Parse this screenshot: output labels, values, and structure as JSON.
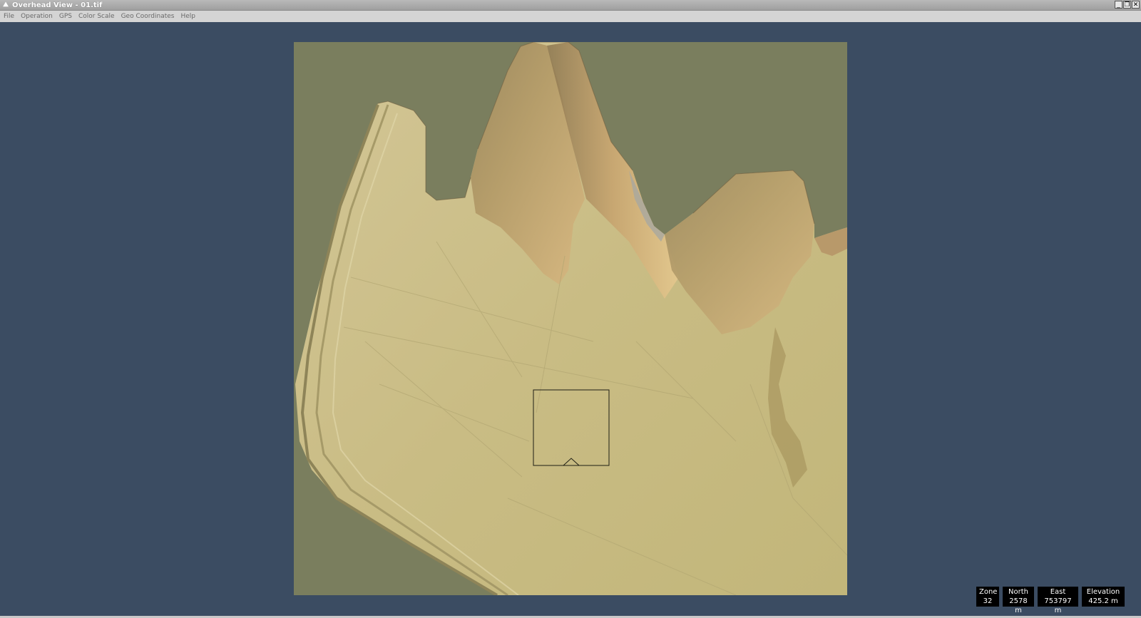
{
  "window": {
    "title": "Overhead View - 01.tif",
    "app_icon": "app-icon",
    "controls": {
      "minimize": "_",
      "restore": "❐",
      "close": "✕"
    }
  },
  "menu": {
    "items": [
      "File",
      "Operation",
      "GPS",
      "Color Scale",
      "Geo Coordinates",
      "Help"
    ]
  },
  "map": {
    "description_icon": "terrain-map",
    "background_color": "#7a7e5e",
    "terrain_color": "#c8bb84"
  },
  "status": {
    "zone_label": "Zone",
    "zone_value": "32",
    "north_label": "North",
    "north_value": "2578 m",
    "east_label": "East",
    "east_value": "753797 m",
    "elevation_label": "Elevation",
    "elevation_value": "425.2  m"
  }
}
